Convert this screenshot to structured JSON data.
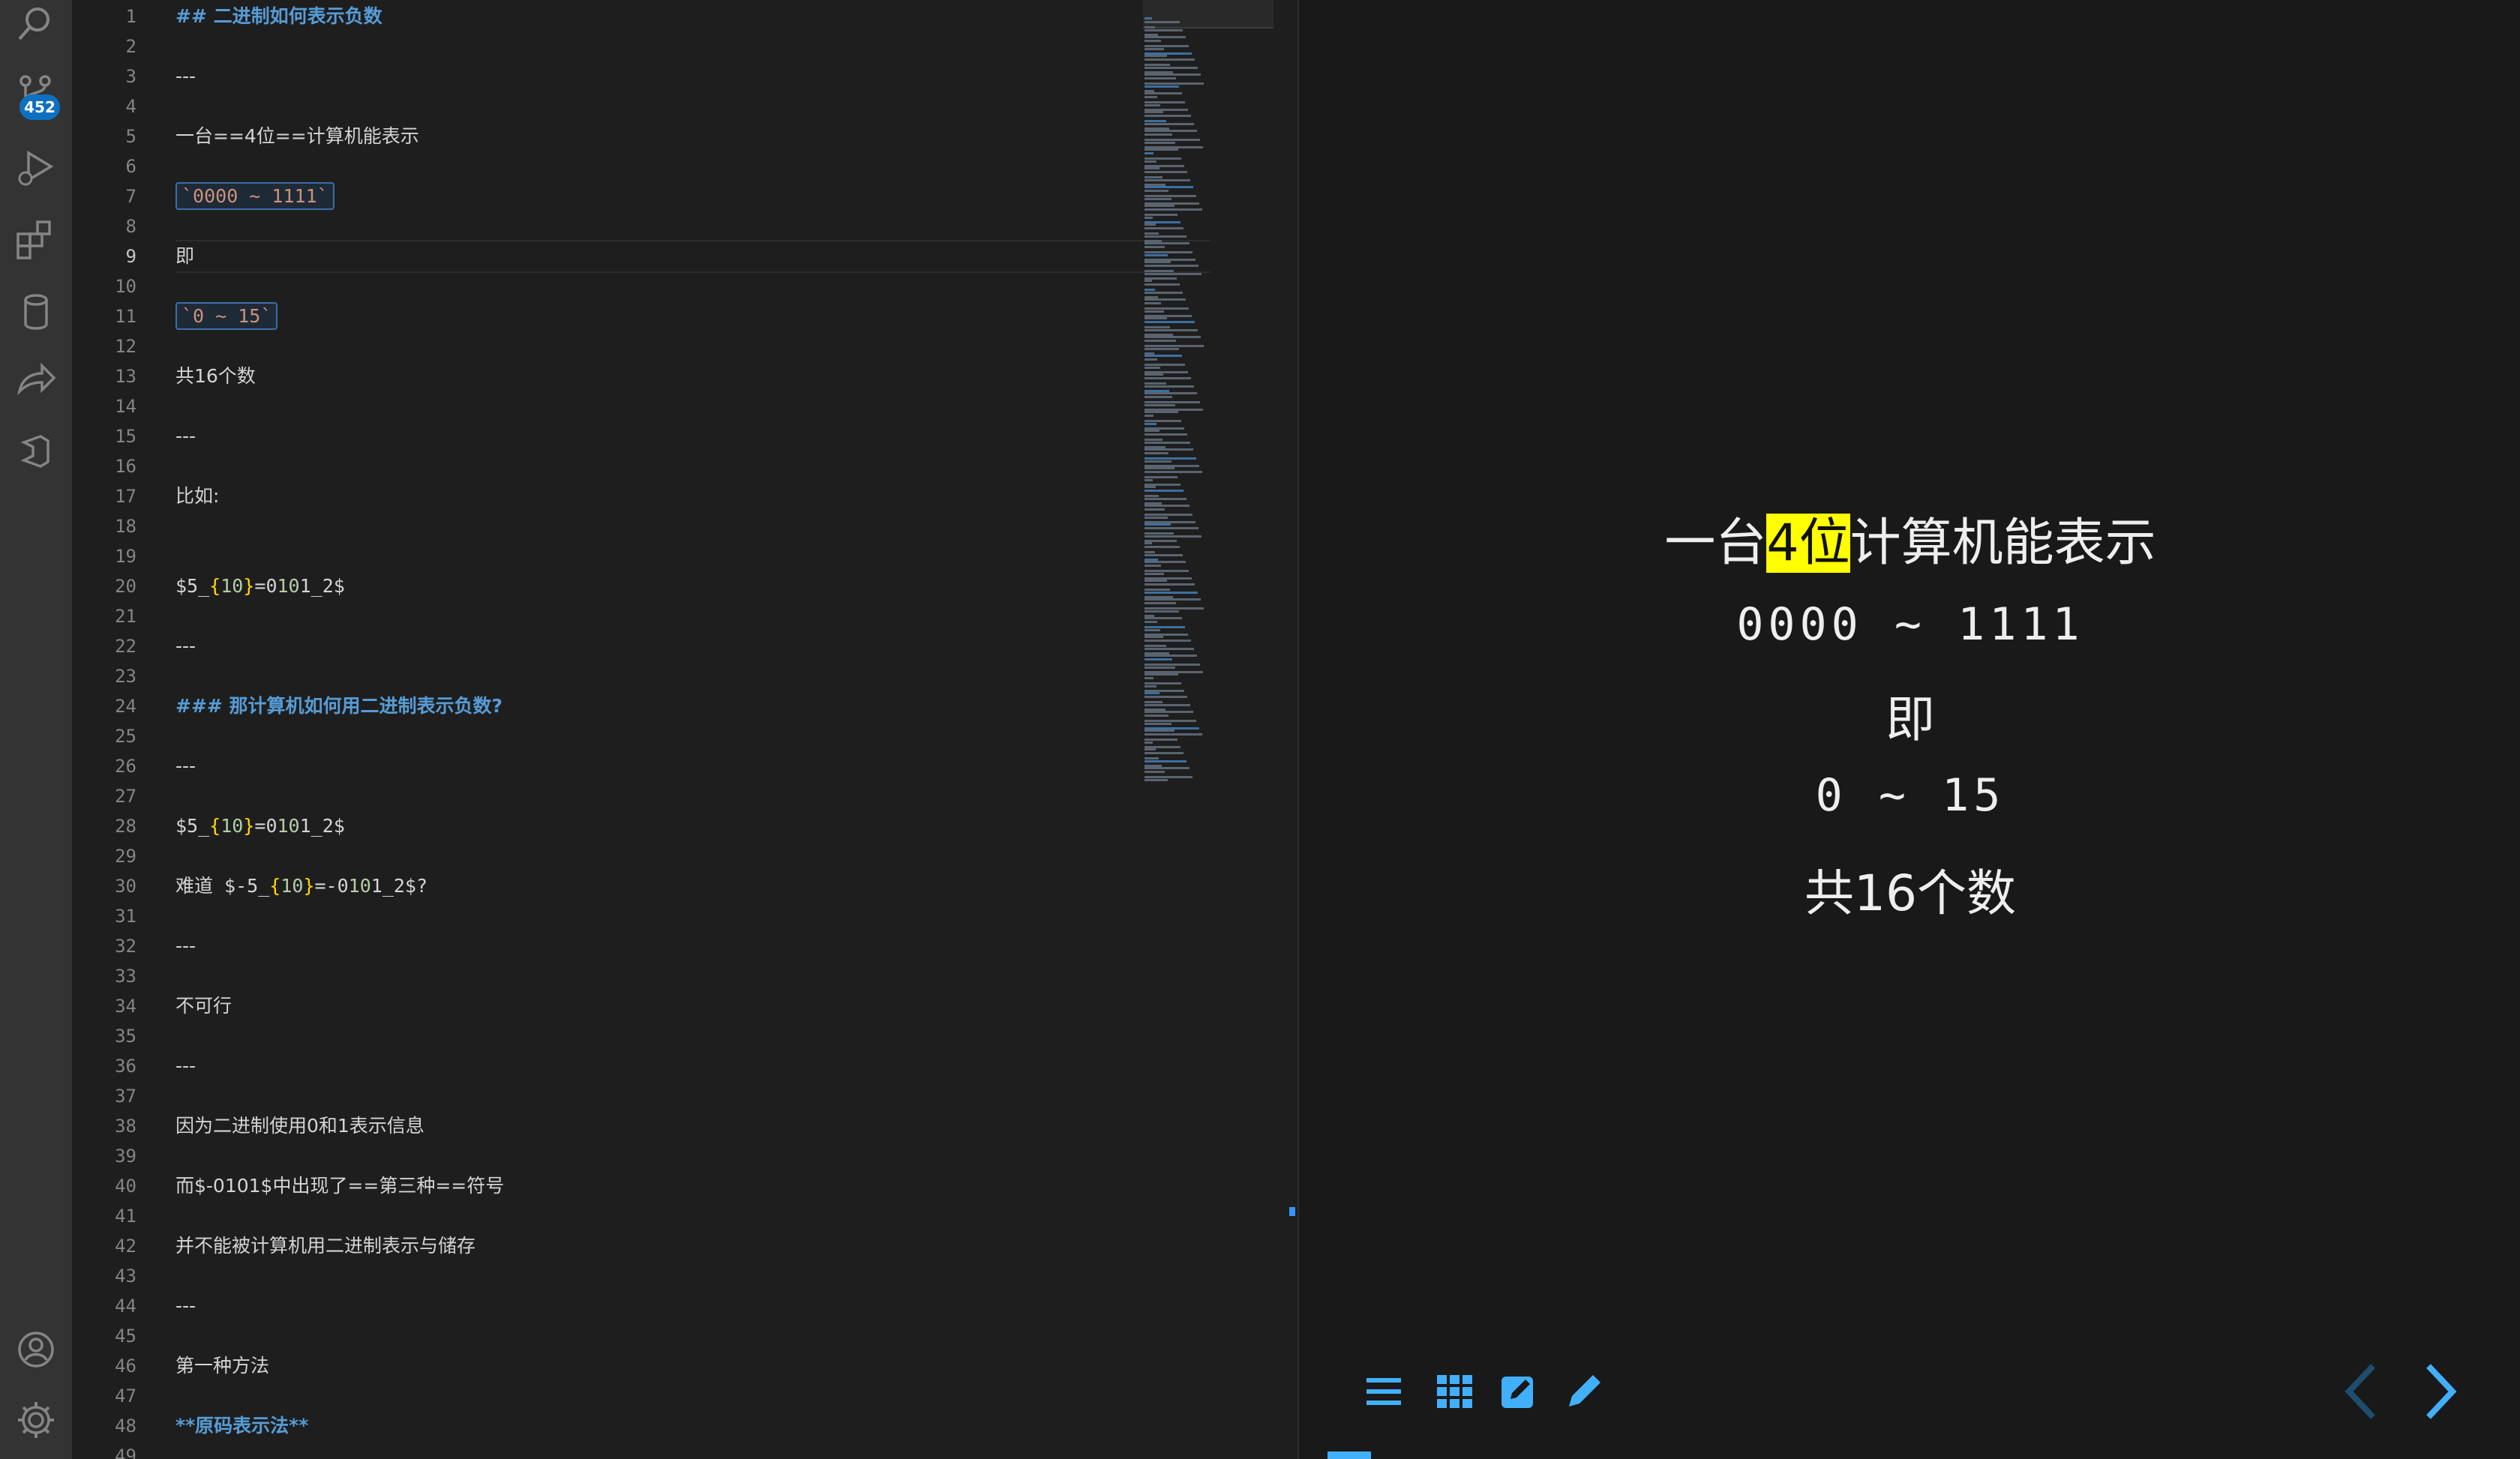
{
  "activity_bar": {
    "scm_badge": "452",
    "icons": [
      "search-icon",
      "source-control-icon",
      "run-debug-icon",
      "extensions-icon",
      "database-icon",
      "remote-share-icon",
      "docker-icon",
      "account-icon",
      "settings-gear-icon"
    ]
  },
  "editor": {
    "active_line": 9,
    "lines": [
      {
        "n": 1,
        "t": "## 二进制如何表示负数",
        "kind": "heading"
      },
      {
        "n": 2,
        "t": ""
      },
      {
        "n": 3,
        "t": "---",
        "kind": "rule"
      },
      {
        "n": 4,
        "t": ""
      },
      {
        "n": 5,
        "t": "一台==4位==计算机能表示"
      },
      {
        "n": 6,
        "t": ""
      },
      {
        "n": 7,
        "t": "`0000 ~ 1111`",
        "kind": "code"
      },
      {
        "n": 8,
        "t": ""
      },
      {
        "n": 9,
        "t": "即"
      },
      {
        "n": 10,
        "t": ""
      },
      {
        "n": 11,
        "t": "`0 ~ 15`",
        "kind": "code"
      },
      {
        "n": 12,
        "t": ""
      },
      {
        "n": 13,
        "t": "共16个数"
      },
      {
        "n": 14,
        "t": ""
      },
      {
        "n": 15,
        "t": "---",
        "kind": "rule"
      },
      {
        "n": 16,
        "t": ""
      },
      {
        "n": 17,
        "t": "比如:"
      },
      {
        "n": 18,
        "t": ""
      },
      {
        "n": 19,
        "t": ""
      },
      {
        "n": 20,
        "t": "$5_{10}=0101_2$",
        "kind": "math"
      },
      {
        "n": 21,
        "t": ""
      },
      {
        "n": 22,
        "t": "---",
        "kind": "rule"
      },
      {
        "n": 23,
        "t": ""
      },
      {
        "n": 24,
        "t": "### 那计算机如何用二进制表示负数?",
        "kind": "heading"
      },
      {
        "n": 25,
        "t": ""
      },
      {
        "n": 26,
        "t": "---",
        "kind": "rule"
      },
      {
        "n": 27,
        "t": ""
      },
      {
        "n": 28,
        "t": "$5_{10}=0101_2$",
        "kind": "math"
      },
      {
        "n": 29,
        "t": ""
      },
      {
        "n": 30,
        "t": "难道 $-5_{10}=-0101_2$?",
        "kind": "math2"
      },
      {
        "n": 31,
        "t": ""
      },
      {
        "n": 32,
        "t": "---",
        "kind": "rule"
      },
      {
        "n": 33,
        "t": ""
      },
      {
        "n": 34,
        "t": "不可行"
      },
      {
        "n": 35,
        "t": ""
      },
      {
        "n": 36,
        "t": "---",
        "kind": "rule"
      },
      {
        "n": 37,
        "t": ""
      },
      {
        "n": 38,
        "t": "因为二进制使用0和1表示信息"
      },
      {
        "n": 39,
        "t": ""
      },
      {
        "n": 40,
        "t": "而$-0101$中出现了==第三种==符号"
      },
      {
        "n": 41,
        "t": ""
      },
      {
        "n": 42,
        "t": "并不能被计算机用二进制表示与储存"
      },
      {
        "n": 43,
        "t": ""
      },
      {
        "n": 44,
        "t": "---",
        "kind": "rule"
      },
      {
        "n": 45,
        "t": ""
      },
      {
        "n": 46,
        "t": "第一种方法"
      },
      {
        "n": 47,
        "t": ""
      },
      {
        "n": 48,
        "t": "**原码表示法**",
        "kind": "bold"
      },
      {
        "n": 49,
        "t": ""
      }
    ]
  },
  "preview": {
    "title_pre": "一台",
    "title_mark": "4位",
    "title_post": "计算机能表示",
    "range1": "0000 ~ 1111",
    "connector": "即",
    "range2": "0 ~ 15",
    "count": "共16个数",
    "controls": [
      "menu-icon",
      "grid-icon",
      "edit-icon",
      "pen-icon",
      "prev-slide-icon",
      "next-slide-icon"
    ]
  },
  "colors": {
    "activity_bg": "#333333",
    "editor_bg": "#1e1e1e",
    "preview_bg": "#191919",
    "accent": "#42affa",
    "highlight": "#ffff00"
  }
}
